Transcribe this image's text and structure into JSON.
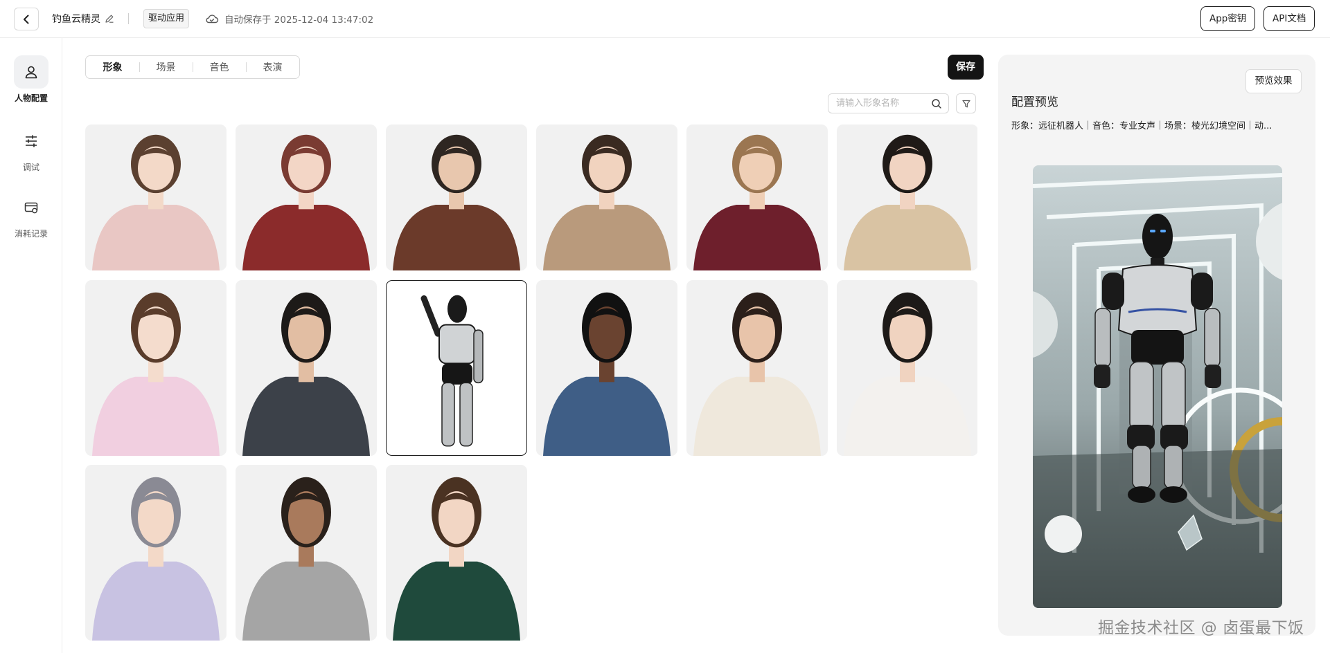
{
  "header": {
    "app_name": "钓鱼云精灵",
    "tag": "驱动应用",
    "autosave": "自动保存于 2025-12-04 13:47:02",
    "app_key_label": "App密钥",
    "api_doc_label": "API文档"
  },
  "nav": {
    "items": [
      {
        "label": "人物配置",
        "icon": "person-icon",
        "active": true
      },
      {
        "label": "调试",
        "icon": "sliders-icon",
        "active": false
      },
      {
        "label": "消耗记录",
        "icon": "card-icon",
        "active": false
      }
    ]
  },
  "tabs": [
    "形象",
    "场景",
    "音色",
    "表演"
  ],
  "save_label": "保存",
  "search": {
    "placeholder": "请输入形象名称"
  },
  "avatars": [
    {
      "bg": "#f1f1f1",
      "hair": "#5b4030",
      "skin": "#f3d9c8",
      "top": "#e9c7c4"
    },
    {
      "bg": "#f1f1f1",
      "hair": "#7a3b32",
      "skin": "#f3d6c6",
      "top": "#8b2b2b"
    },
    {
      "bg": "#f1f1f1",
      "hair": "#2e2621",
      "skin": "#e8c7ae",
      "top": "#6b3a2a"
    },
    {
      "bg": "#f1f1f1",
      "hair": "#3a2a21",
      "skin": "#f1d3bf",
      "top": "#b99a7c"
    },
    {
      "bg": "#f1f1f1",
      "hair": "#9b7651",
      "skin": "#efcfb6",
      "top": "#6e1f2c"
    },
    {
      "bg": "#f1f1f1",
      "hair": "#1f1a17",
      "skin": "#f1d4c2",
      "top": "#d9c3a3"
    },
    {
      "bg": "#f1f1f1",
      "hair": "#5a3c2b",
      "skin": "#f4dccd",
      "top": "#f1cfe0"
    },
    {
      "bg": "#f1f1f1",
      "hair": "#1d1a18",
      "skin": "#e2bea3",
      "top": "#3c4149"
    },
    {
      "bg": "#ffffff",
      "hair": "#1a1a1a",
      "skin": "#c8c8c8",
      "top": "#9a9a9a",
      "robot": true
    },
    {
      "bg": "#f1f1f1",
      "hair": "#111111",
      "skin": "#6a4330",
      "top": "#3f5e86"
    },
    {
      "bg": "#f1f1f1",
      "hair": "#2b1f1a",
      "skin": "#e8c4aa",
      "top": "#efe8dc"
    },
    {
      "bg": "#f1f1f1",
      "hair": "#1d1a18",
      "skin": "#f0d3c0",
      "top": "#f3f1ee"
    },
    {
      "bg": "#f1f1f1",
      "hair": "#8a8a94",
      "skin": "#f3d9c8",
      "top": "#c8c2e2"
    },
    {
      "bg": "#f1f1f1",
      "hair": "#2a211b",
      "skin": "#a97a5c",
      "top": "#a5a5a5"
    },
    {
      "bg": "#f1f1f1",
      "hair": "#4a3222",
      "skin": "#f2d6c4",
      "top": "#1f4a3c"
    }
  ],
  "preview": {
    "button_label": "预览效果",
    "title": "配置预览",
    "summary": "形象：远征机器人｜音色：专业女声｜场景：棱光幻境空间｜动..."
  },
  "watermark": "掘金技术社区 @ 卤蛋最下饭"
}
